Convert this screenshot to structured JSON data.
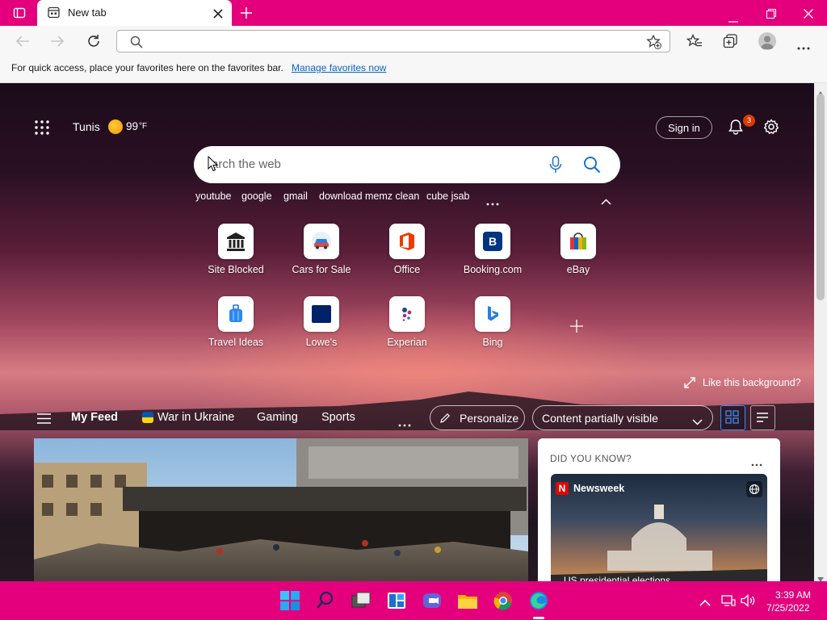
{
  "browser": {
    "tab_title": "New tab",
    "address_value": "",
    "favorites_bar_text": "For quick access, place your favorites here on the favorites bar.",
    "favorites_bar_link": "Manage favorites now"
  },
  "newtab": {
    "location": "Tunis",
    "temperature": "99",
    "temperature_unit": "°F",
    "sign_in_label": "Sign in",
    "notification_count": "3",
    "search_placeholder": "Search the web",
    "search_visible_text": "arch the web",
    "quick_searches": [
      "youtube",
      "google",
      "gmail",
      "download memz clean",
      "cube jsab"
    ],
    "quick_links": [
      {
        "label": "Site Blocked",
        "icon": "museum-icon"
      },
      {
        "label": "Cars for Sale",
        "icon": "car-icon"
      },
      {
        "label": "Office",
        "icon": "office-icon"
      },
      {
        "label": "Booking.com",
        "icon": "booking-icon"
      },
      {
        "label": "eBay",
        "icon": "ebay-bag-icon"
      },
      {
        "label": "Travel Ideas",
        "icon": "suitcase-icon"
      },
      {
        "label": "Lowe's",
        "icon": "lowes-icon"
      },
      {
        "label": "Experian",
        "icon": "experian-icon"
      },
      {
        "label": "Bing",
        "icon": "bing-icon"
      }
    ],
    "background_label": "Like this background?"
  },
  "feed": {
    "tabs": [
      "My Feed",
      "War in Ukraine",
      "Gaming",
      "Sports"
    ],
    "personalize_label": "Personalize",
    "content_visibility": "Content partially visible",
    "did_you_know_label": "DID YOU KNOW?",
    "source_name": "Newsweek",
    "source_badge": "N",
    "headline_partial": "US presidential elections"
  },
  "taskbar": {
    "time": "3:39 AM",
    "date": "7/25/2022"
  },
  "colors": {
    "titlebar": "#e4007c",
    "taskbar": "#e4007c",
    "link": "#0a62c9",
    "accent_blue": "#3b8cff"
  }
}
